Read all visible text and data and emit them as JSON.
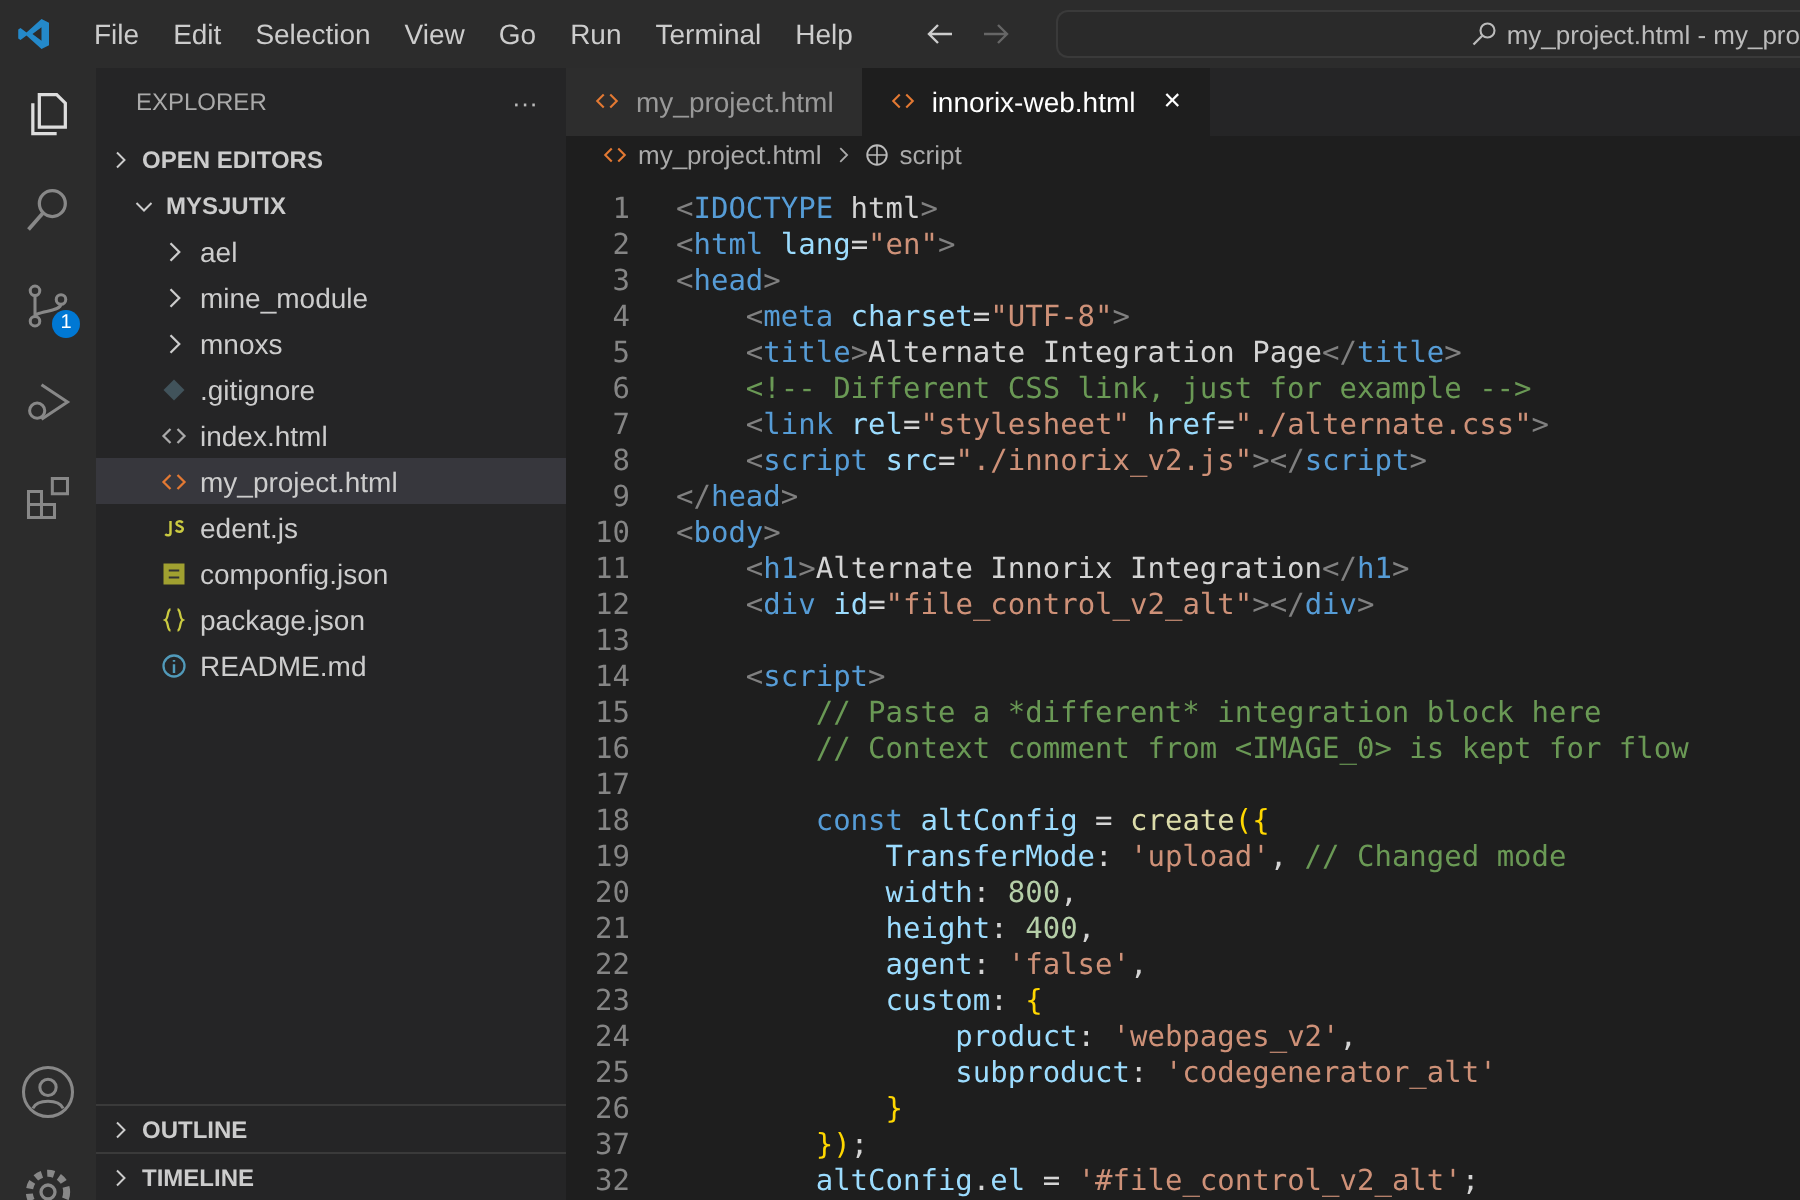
{
  "menu": [
    "File",
    "Edit",
    "Selection",
    "View",
    "Go",
    "Run",
    "Terminal",
    "Help"
  ],
  "command_center": {
    "text": "my_project.html - my_pro"
  },
  "activity_bar": {
    "source_control_badge": "1"
  },
  "sidebar": {
    "title": "EXPLORER",
    "more": "···",
    "sections": [
      {
        "label": "OPEN EDITORS",
        "expanded": false
      },
      {
        "label": "MYSJUTIX",
        "expanded": true,
        "children": [
          {
            "label": "ael",
            "kind": "folder",
            "expanded": false,
            "selected": false
          },
          {
            "label": "mine_module",
            "kind": "folder",
            "expanded": false,
            "selected": false
          },
          {
            "label": "mnoxs",
            "kind": "folder",
            "expanded": false,
            "selected": false
          },
          {
            "label": ".gitignore",
            "kind": "git",
            "selected": false
          },
          {
            "label": "index.html",
            "kind": "html",
            "selected": false
          },
          {
            "label": "my_project.html",
            "kind": "html",
            "selected": true
          },
          {
            "label": "edent.js",
            "kind": "js",
            "selected": false
          },
          {
            "label": "componfig.json",
            "kind": "config",
            "selected": false
          },
          {
            "label": "package.json",
            "kind": "json",
            "selected": false
          },
          {
            "label": "README.md",
            "kind": "info",
            "selected": false
          }
        ]
      }
    ],
    "bottom_sections": [
      {
        "label": "OUTLINE",
        "expanded": false
      },
      {
        "label": "TIMELINE",
        "expanded": false
      }
    ]
  },
  "tabs": [
    {
      "label": "my_project.html",
      "selected": false
    },
    {
      "label": "innorix-web.html",
      "selected": true,
      "close": "×"
    }
  ],
  "breadcrumbs": [
    "my_project.html",
    "script"
  ],
  "code": [
    {
      "n": "1",
      "t": [
        {
          "kind": "p",
          "text": "<"
        },
        {
          "kind": "tag",
          "text": "IDOCTYPE"
        },
        {
          "kind": "tx",
          "text": " html"
        },
        {
          "kind": "p",
          "text": ">"
        }
      ]
    },
    {
      "n": "2",
      "t": [
        {
          "kind": "p",
          "text": "<"
        },
        {
          "kind": "tag",
          "text": "html"
        },
        {
          "kind": "at",
          "text": " lang"
        },
        {
          "kind": "tx",
          "text": "="
        },
        {
          "kind": "s",
          "text": "\"en\""
        },
        {
          "kind": "p",
          "text": ">"
        }
      ]
    },
    {
      "n": "3",
      "t": [
        {
          "kind": "p",
          "text": "<"
        },
        {
          "kind": "tag",
          "text": "head"
        },
        {
          "kind": "p",
          "text": ">"
        }
      ]
    },
    {
      "n": "4",
      "t": [
        {
          "kind": "p",
          "text": "    <"
        },
        {
          "kind": "tag",
          "text": "meta"
        },
        {
          "kind": "at",
          "text": " charset"
        },
        {
          "kind": "tx",
          "text": "="
        },
        {
          "kind": "s",
          "text": "\"UTF-8\""
        },
        {
          "kind": "p",
          "text": ">"
        }
      ]
    },
    {
      "n": "5",
      "t": [
        {
          "kind": "p",
          "text": "    <"
        },
        {
          "kind": "tag",
          "text": "title"
        },
        {
          "kind": "p",
          "text": ">"
        },
        {
          "kind": "tx",
          "text": "Alternate Integration Page"
        },
        {
          "kind": "p",
          "text": "</"
        },
        {
          "kind": "tag",
          "text": "title"
        },
        {
          "kind": "p",
          "text": ">"
        }
      ]
    },
    {
      "n": "6",
      "t": [
        {
          "kind": "c",
          "text": "    <!-- Different CSS link, just for example -->"
        }
      ]
    },
    {
      "n": "7",
      "t": [
        {
          "kind": "p",
          "text": "    <"
        },
        {
          "kind": "tag",
          "text": "link"
        },
        {
          "kind": "at",
          "text": " rel"
        },
        {
          "kind": "tx",
          "text": "="
        },
        {
          "kind": "s",
          "text": "\"stylesheet\""
        },
        {
          "kind": "at",
          "text": " href"
        },
        {
          "kind": "tx",
          "text": "="
        },
        {
          "kind": "s",
          "text": "\"./alternate.css\""
        },
        {
          "kind": "p",
          "text": ">"
        }
      ]
    },
    {
      "n": "8",
      "t": [
        {
          "kind": "p",
          "text": "    <"
        },
        {
          "kind": "tag",
          "text": "script"
        },
        {
          "kind": "at",
          "text": " src"
        },
        {
          "kind": "tx",
          "text": "="
        },
        {
          "kind": "s",
          "text": "\"./innorix_v2.js\""
        },
        {
          "kind": "p",
          "text": "></"
        },
        {
          "kind": "tag",
          "text": "script"
        },
        {
          "kind": "p",
          "text": ">"
        }
      ]
    },
    {
      "n": "9",
      "t": [
        {
          "kind": "p",
          "text": "</"
        },
        {
          "kind": "tag",
          "text": "head"
        },
        {
          "kind": "p",
          "text": ">"
        }
      ]
    },
    {
      "n": "10",
      "t": [
        {
          "kind": "p",
          "text": "<"
        },
        {
          "kind": "tag",
          "text": "body"
        },
        {
          "kind": "p",
          "text": ">"
        }
      ]
    },
    {
      "n": "11",
      "t": [
        {
          "kind": "p",
          "text": "    <"
        },
        {
          "kind": "tag",
          "text": "h1"
        },
        {
          "kind": "p",
          "text": ">"
        },
        {
          "kind": "tx",
          "text": "Alternate Innorix Integration"
        },
        {
          "kind": "p",
          "text": "</"
        },
        {
          "kind": "tag",
          "text": "h1"
        },
        {
          "kind": "p",
          "text": ">"
        }
      ]
    },
    {
      "n": "12",
      "t": [
        {
          "kind": "p",
          "text": "    <"
        },
        {
          "kind": "tag",
          "text": "div"
        },
        {
          "kind": "at",
          "text": " id"
        },
        {
          "kind": "tx",
          "text": "="
        },
        {
          "kind": "s",
          "text": "\"file_control_v2_alt\""
        },
        {
          "kind": "p",
          "text": "></"
        },
        {
          "kind": "tag",
          "text": "div"
        },
        {
          "kind": "p",
          "text": ">"
        }
      ]
    },
    {
      "n": "13"
    },
    {
      "n": "14",
      "t": [
        {
          "kind": "p",
          "text": "    <"
        },
        {
          "kind": "tag",
          "text": "script"
        },
        {
          "kind": "p",
          "text": ">"
        }
      ]
    },
    {
      "n": "15",
      "t": [
        {
          "kind": "c",
          "text": "        // Paste a *different* integration block here"
        }
      ]
    },
    {
      "n": "16",
      "t": [
        {
          "kind": "c",
          "text": "        // Context comment from <IMAGE_0> is kept for flow"
        }
      ]
    },
    {
      "n": "17"
    },
    {
      "n": "18",
      "t": [
        {
          "kind": "kw",
          "text": "        const"
        },
        {
          "kind": "v",
          "text": " altConfig"
        },
        {
          "kind": "tx",
          "text": " = "
        },
        {
          "kind": "fn",
          "text": "create"
        },
        {
          "kind": "b",
          "text": "({"
        }
      ]
    },
    {
      "n": "19",
      "t": [
        {
          "kind": "v",
          "text": "            TransferMode"
        },
        {
          "kind": "tx",
          "text": ": "
        },
        {
          "kind": "s",
          "text": "'upload'"
        },
        {
          "kind": "tx",
          "text": ", "
        },
        {
          "kind": "c",
          "text": "// Changed mode"
        }
      ]
    },
    {
      "n": "20",
      "t": [
        {
          "kind": "v",
          "text": "            width"
        },
        {
          "kind": "tx",
          "text": ": "
        },
        {
          "kind": "num",
          "text": "800"
        },
        {
          "kind": "tx",
          "text": ","
        }
      ]
    },
    {
      "n": "21",
      "t": [
        {
          "kind": "v",
          "text": "            height"
        },
        {
          "kind": "tx",
          "text": ": "
        },
        {
          "kind": "num",
          "text": "400"
        },
        {
          "kind": "tx",
          "text": ","
        }
      ]
    },
    {
      "n": "22",
      "t": [
        {
          "kind": "v",
          "text": "            agent"
        },
        {
          "kind": "tx",
          "text": ": "
        },
        {
          "kind": "s",
          "text": "'false'"
        },
        {
          "kind": "tx",
          "text": ","
        }
      ]
    },
    {
      "n": "23",
      "t": [
        {
          "kind": "v",
          "text": "            custom"
        },
        {
          "kind": "tx",
          "text": ": "
        },
        {
          "kind": "b",
          "text": "{"
        }
      ]
    },
    {
      "n": "24",
      "t": [
        {
          "kind": "v",
          "text": "                product"
        },
        {
          "kind": "tx",
          "text": ": "
        },
        {
          "kind": "s",
          "text": "'webpages_v2'"
        },
        {
          "kind": "tx",
          "text": ","
        }
      ]
    },
    {
      "n": "25",
      "t": [
        {
          "kind": "v",
          "text": "                subproduct"
        },
        {
          "kind": "tx",
          "text": ": "
        },
        {
          "kind": "s",
          "text": "'codegenerator_alt'"
        }
      ]
    },
    {
      "n": "26",
      "t": [
        {
          "kind": "b",
          "text": "            }"
        }
      ]
    },
    {
      "n": "37",
      "t": [
        {
          "kind": "b",
          "text": "        })"
        },
        {
          "kind": "tx",
          "text": ";"
        }
      ]
    },
    {
      "n": "32",
      "t": [
        {
          "kind": "v",
          "text": "        altConfig"
        },
        {
          "kind": "tx",
          "text": "."
        },
        {
          "kind": "v",
          "text": "el"
        },
        {
          "kind": "tx",
          "text": " = "
        },
        {
          "kind": "s",
          "text": "'#file_control_v2_alt'"
        },
        {
          "kind": "tx",
          "text": ";"
        }
      ]
    }
  ]
}
